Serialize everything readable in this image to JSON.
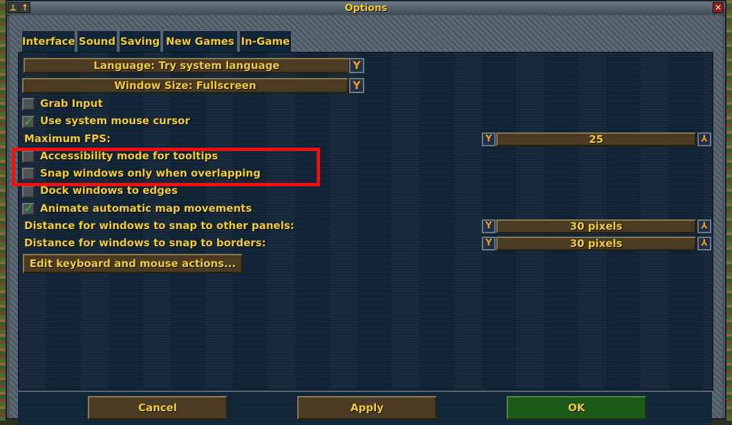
{
  "window": {
    "title": "Options"
  },
  "tabs": [
    {
      "label": "Interface",
      "active": true
    },
    {
      "label": "Sound",
      "active": false
    },
    {
      "label": "Saving",
      "active": false
    },
    {
      "label": "New Games",
      "active": false
    },
    {
      "label": "In-Game",
      "active": false
    }
  ],
  "interface": {
    "language_dropdown": "Language: Try system language",
    "window_size_dropdown": "Window Size: Fullscreen",
    "grab_input": {
      "label": "Grab Input",
      "checked": false
    },
    "system_cursor": {
      "label": "Use system mouse cursor",
      "checked": true
    },
    "max_fps": {
      "label": "Maximum FPS:",
      "value": "25"
    },
    "accessibility_tooltips": {
      "label": "Accessibility mode for tooltips",
      "checked": false
    },
    "snap_overlapping": {
      "label": "Snap windows only when overlapping",
      "checked": false
    },
    "dock_edges": {
      "label": "Dock windows to edges",
      "checked": false
    },
    "animate_map": {
      "label": "Animate automatic map movements",
      "checked": true
    },
    "snap_panels": {
      "label": "Distance for windows to snap to other panels:",
      "value": "30 pixels"
    },
    "snap_borders": {
      "label": "Distance for windows to snap to borders:",
      "value": "30 pixels"
    },
    "edit_keys_button": "Edit keyboard and mouse actions..."
  },
  "buttons": {
    "cancel": "Cancel",
    "apply": "Apply",
    "ok": "OK"
  },
  "icons": {
    "pin": "pin-icon",
    "minimize": "minimize-icon",
    "close": "close-icon",
    "dropdown": "chevron-down-icon"
  },
  "colors": {
    "text": "#f3cc2e",
    "highlight": "#ee1111",
    "check": "#26c926"
  }
}
